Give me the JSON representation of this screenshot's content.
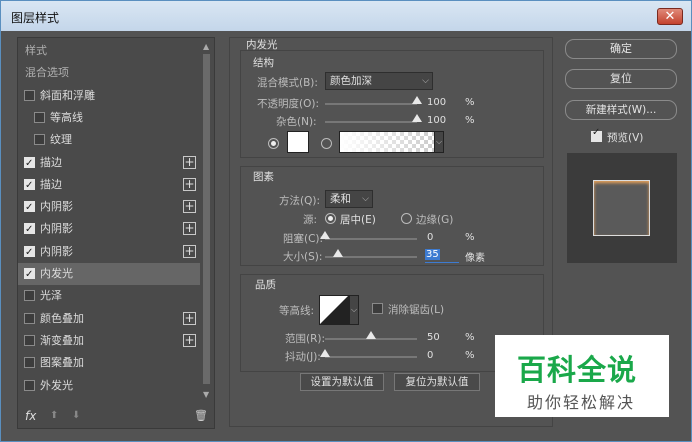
{
  "window": {
    "title": "图层样式",
    "close_label": "✕"
  },
  "sidebar": {
    "items": [
      {
        "label": "样式"
      },
      {
        "label": "混合选项"
      },
      {
        "label": "斜面和浮雕"
      },
      {
        "label": "等高线"
      },
      {
        "label": "纹理"
      },
      {
        "label": "描边",
        "plus": "+"
      },
      {
        "label": "描边",
        "plus": "+"
      },
      {
        "label": "内阴影",
        "plus": "+"
      },
      {
        "label": "内阴影",
        "plus": "+"
      },
      {
        "label": "内阴影",
        "plus": "+"
      },
      {
        "label": "内发光"
      },
      {
        "label": "光泽"
      },
      {
        "label": "颜色叠加",
        "plus": "+"
      },
      {
        "label": "渐变叠加",
        "plus": "+"
      },
      {
        "label": "图案叠加"
      },
      {
        "label": "外发光"
      }
    ],
    "checked": [
      false,
      false,
      false,
      false,
      false,
      true,
      true,
      true,
      true,
      true,
      true,
      false,
      false,
      false,
      false,
      false
    ],
    "footer": {
      "fx": "fx",
      "up": "⬆",
      "down": "⬇",
      "trash": "🗑"
    }
  },
  "inner_glow": {
    "title": "内发光",
    "structure": {
      "title": "结构",
      "blend_mode_label": "混合模式(B):",
      "blend_mode_value": "颜色加深",
      "opacity_label": "不透明度(O):",
      "opacity_value": "100",
      "opacity_unit": "%",
      "opacity_level": 1.0,
      "noise_label": "杂色(N):",
      "noise_value": "100",
      "noise_unit": "%",
      "noise_level": 1.0,
      "color_swatch": "#ffffff"
    },
    "elements": {
      "title": "图素",
      "method_label": "方法(Q):",
      "method_value": "柔和",
      "source_label": "源:",
      "source_center": "居中(E)",
      "source_edge": "边缘(G)",
      "choke_label": "阻塞(C):",
      "choke_value": "0",
      "choke_unit": "%",
      "choke_level": 0.0,
      "size_label": "大小(S):",
      "size_value": "35",
      "size_unit": "像素",
      "size_level": 0.14
    },
    "quality": {
      "title": "品质",
      "contour_label": "等高线:",
      "antialias_label": "消除锯齿(L)",
      "range_label": "范围(R):",
      "range_value": "50",
      "range_unit": "%",
      "range_level": 0.5,
      "jitter_label": "抖动(J):",
      "jitter_value": "0",
      "jitter_unit": "%",
      "jitter_level": 0.0
    },
    "set_default": "设置为默认值",
    "reset_default": "复位为默认值"
  },
  "actions": {
    "ok": "确定",
    "reset": "复位",
    "new_style": "新建样式(W)...",
    "preview_label": "预览(V)"
  },
  "watermark": {
    "line1": "百科全说",
    "line2": "助你轻松解决"
  }
}
